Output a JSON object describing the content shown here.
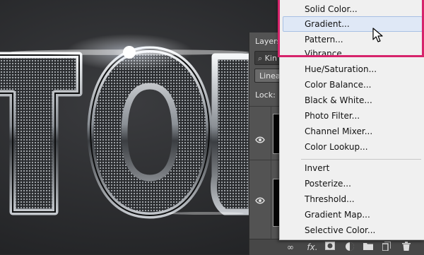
{
  "canvas": {
    "letters": [
      "T",
      "O",
      "U"
    ],
    "background": "#2e2f31",
    "chrome_color": "#c9cdd2"
  },
  "layers_panel": {
    "tab_label": "Layers",
    "filter_label": "Kin",
    "blend_mode": "Linear",
    "lock_label": "Lock:",
    "bottom_icons": [
      "link-icon",
      "fx-icon",
      "mask-icon",
      "adjustment-icon",
      "folder-icon",
      "new-layer-icon",
      "trash-icon"
    ],
    "fx_label": "fx."
  },
  "menu": {
    "group1": [
      "Solid Color...",
      "Gradient...",
      "Pattern..."
    ],
    "group2": [
      "Vibrance...",
      "Hue/Saturation...",
      "Color Balance...",
      "Black & White...",
      "Photo Filter...",
      "Channel Mixer...",
      "Color Lookup..."
    ],
    "group3": [
      "Invert",
      "Posterize...",
      "Threshold...",
      "Gradient Map...",
      "Selective Color..."
    ],
    "hovered_item": "Gradient...",
    "highlight_color": "#d6236b"
  }
}
